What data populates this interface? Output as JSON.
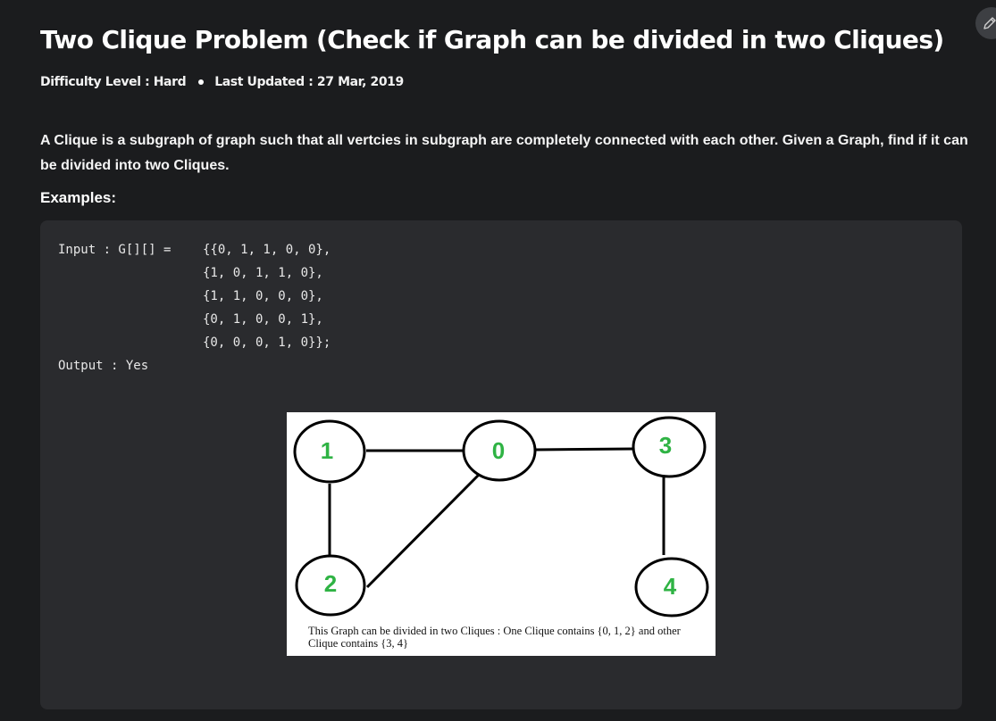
{
  "article": {
    "title": "Two Clique Problem (Check if Graph can be divided in two Cliques)",
    "difficulty": "Difficulty Level : Hard",
    "last_updated": "Last Updated : 27 Mar, 2019",
    "intro": "A Clique is a subgraph of graph such that all vertcies in subgraph are completely connected with each other. Given a Graph, find if it can be divided into two Cliques.",
    "examples_heading": "Examples:"
  },
  "code": {
    "input_label": "Input : G[][] =",
    "matrix_rows": [
      "{{0, 1, 1, 0, 0},",
      "{1, 0, 1, 1, 0},",
      "{1, 1, 0, 0, 0},",
      "{0, 1, 0, 0, 1},",
      "{0, 0, 0, 1, 0}};"
    ],
    "output_line": "Output : Yes"
  },
  "figure": {
    "nodes": [
      "1",
      "0",
      "3",
      "2",
      "4"
    ],
    "caption": "This Graph can be divided in two Cliques : One Clique contains {0, 1, 2} and other Clique contains {3, 4}",
    "node_label_color": "#2fb344"
  },
  "toolbar": {
    "edit_icon": "pencil-icon"
  }
}
